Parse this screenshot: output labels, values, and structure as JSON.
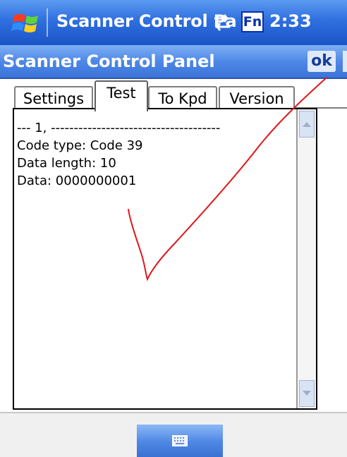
{
  "statusbar": {
    "title": "Scanner Control Pa",
    "fn_label": "Fn",
    "time": "2:33",
    "start_icon": "windows-flag-icon",
    "connectivity_icon": "connectivity-arrows-icon"
  },
  "app": {
    "title": "Scanner Control Panel",
    "ok_label": "ok"
  },
  "tabs": [
    {
      "label": "Settings",
      "active": false
    },
    {
      "label": "Test",
      "active": true
    },
    {
      "label": "To Kpd",
      "active": false
    },
    {
      "label": "Version",
      "active": false
    }
  ],
  "output": {
    "lines": [
      "--- 1, -------------------------------------",
      "Code type: Code 39",
      "Data length: 10",
      "Data: 0000000001"
    ]
  },
  "bottombar": {
    "keyboard_icon": "keyboard-icon"
  },
  "colors": {
    "titlebar": "#2f6fe0",
    "annotation": "#e0161b"
  }
}
